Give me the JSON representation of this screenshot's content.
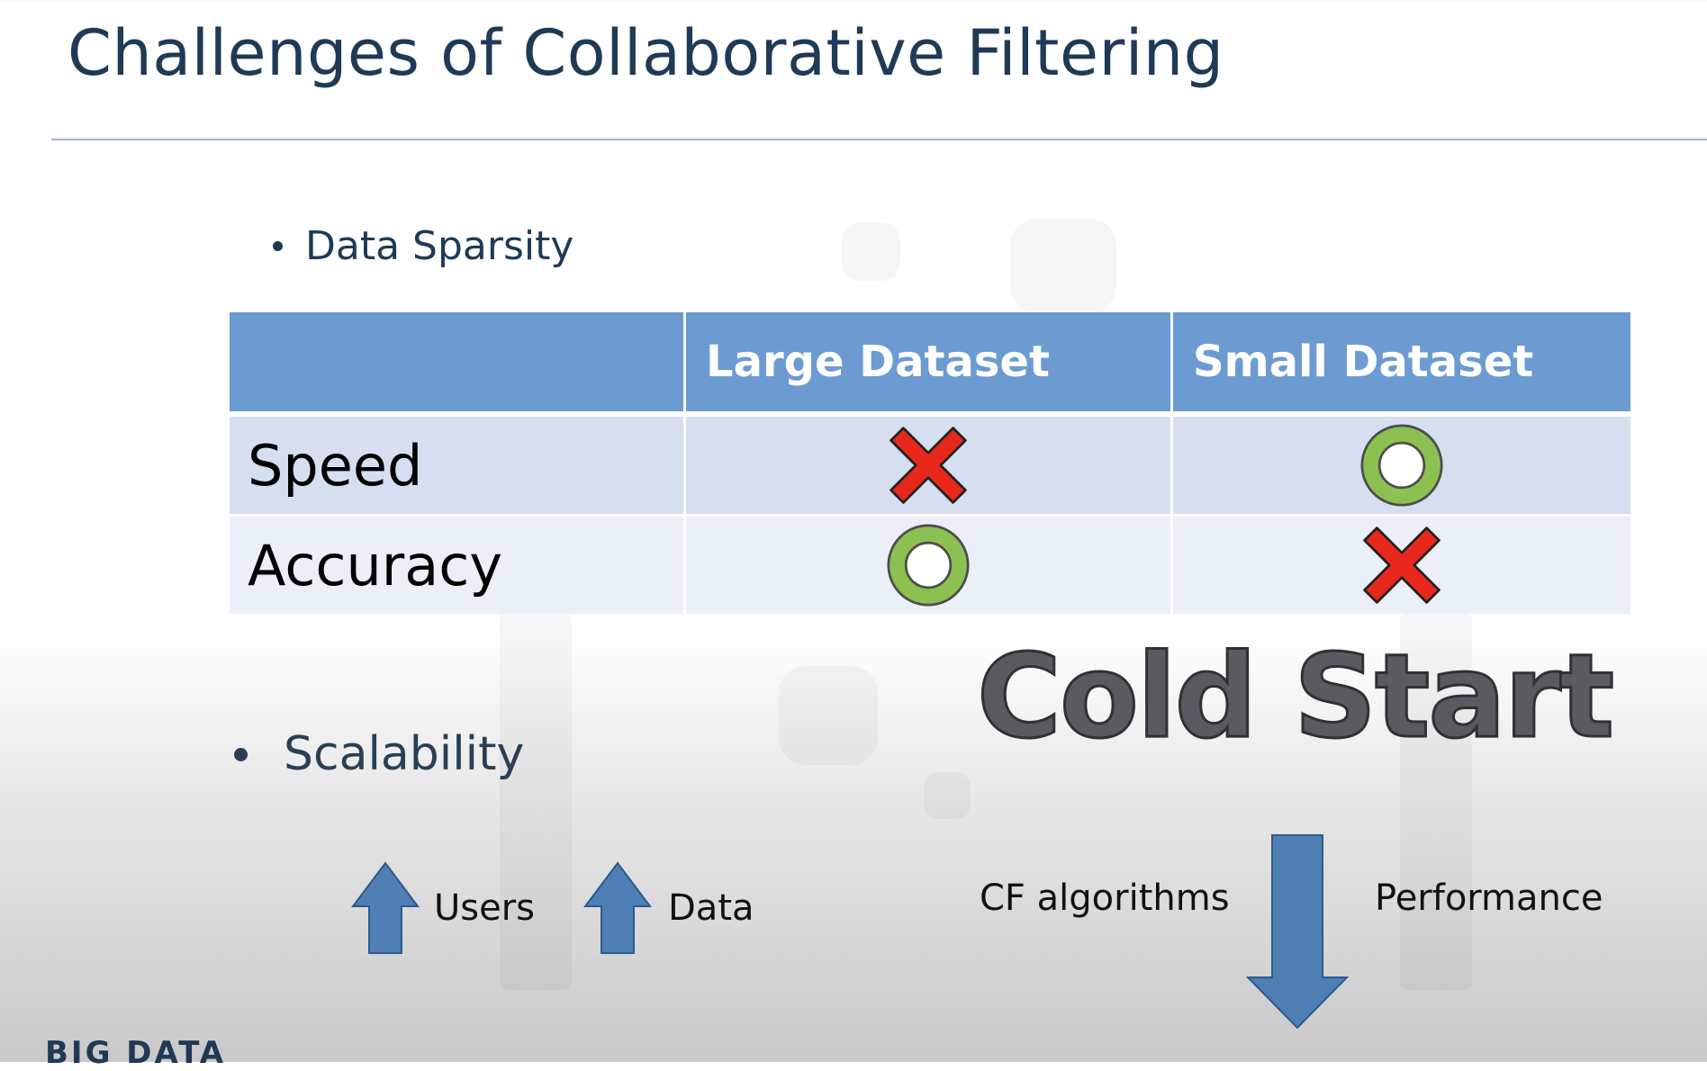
{
  "slide": {
    "title": "Challenges of Collaborative Filtering"
  },
  "bullets": {
    "data_sparsity": "Data Sparsity",
    "scalability": "Scalability"
  },
  "table": {
    "columns": [
      "",
      "Large Dataset",
      "Small Dataset"
    ],
    "rows": [
      {
        "label": "Speed",
        "large": "cross",
        "small": "circle"
      },
      {
        "label": "Accuracy",
        "large": "circle",
        "small": "cross"
      }
    ]
  },
  "cold_start": "Cold Start",
  "scalability_arrows": {
    "users_label": "Users",
    "data_label": "Data",
    "cf_label": "CF algorithms",
    "performance_label": "Performance"
  },
  "logo": {
    "text": "BIG DATA"
  },
  "colors": {
    "title": "#1f3a56",
    "table_header": "#6b9bd1",
    "arrow": "#4f7fb5",
    "cross": "#e8281c",
    "circle": "#8cc152"
  },
  "icons": {
    "up_arrow": "arrow-up-icon",
    "down_arrow": "arrow-down-icon",
    "cross": "cross-icon",
    "circle": "circle-icon"
  }
}
